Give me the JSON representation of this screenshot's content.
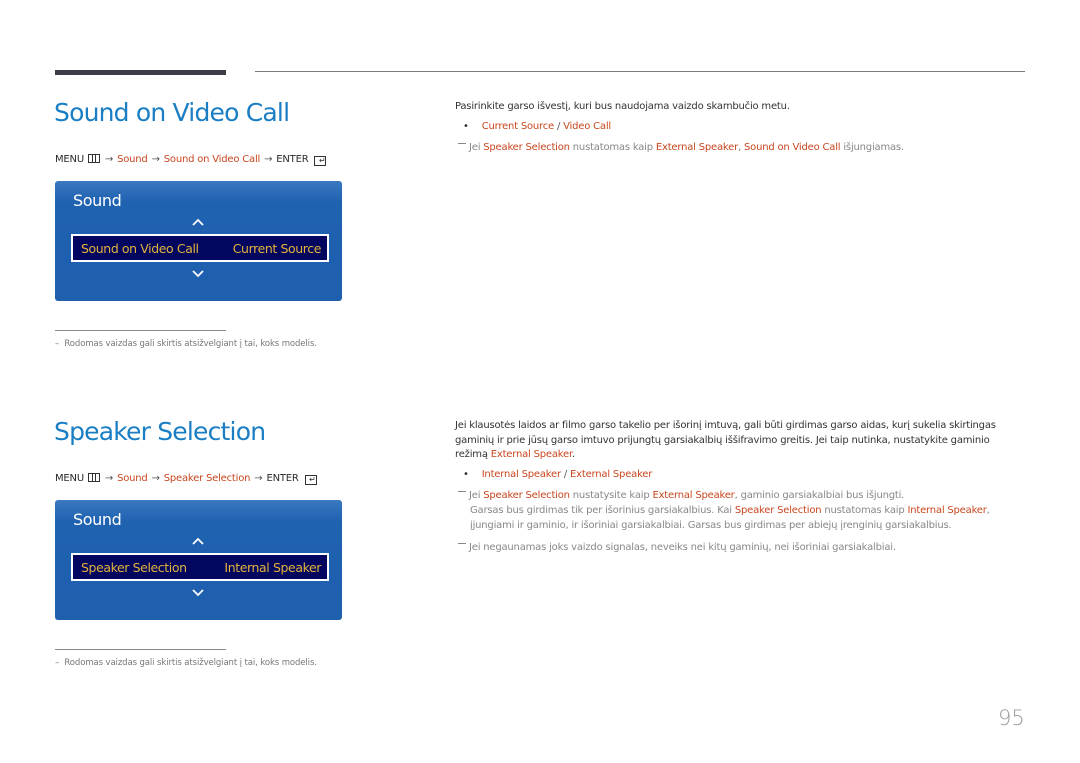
{
  "page_number": "95",
  "sections": [
    {
      "title": "Sound on Video Call",
      "menu_path": {
        "menu": "MENU",
        "menu_icon": "menu-icon",
        "arrow": "→",
        "steps": [
          "Sound",
          "Sound on Video Call"
        ],
        "enter": "ENTER",
        "enter_icon": "enter-icon"
      },
      "osd": {
        "title": "Sound",
        "item_label": "Sound on Video Call",
        "item_value": "Current Source"
      },
      "footnote": "Rodomas vaizdas gali skirtis atsižvelgiant į tai, koks modelis.",
      "footnote_dash": "–",
      "description": "Pasirinkite garso išvestį, kuri bus naudojama vaizdo skambučio metu.",
      "options": [
        "Current Source",
        "Video Call"
      ],
      "option_separator": "/",
      "notes": [
        {
          "parts": [
            "Jei ",
            "Speaker Selection",
            " nustatomas kaip ",
            "External Speaker",
            ", ",
            "Sound on Video Call",
            " išjungiamas."
          ]
        }
      ]
    },
    {
      "title": "Speaker Selection",
      "menu_path": {
        "menu": "MENU",
        "menu_icon": "menu-icon",
        "arrow": "→",
        "steps": [
          "Sound",
          "Speaker Selection"
        ],
        "enter": "ENTER",
        "enter_icon": "enter-icon"
      },
      "osd": {
        "title": "Sound",
        "item_label": "Speaker Selection",
        "item_value": "Internal Speaker"
      },
      "footnote": "Rodomas vaizdas gali skirtis atsižvelgiant į tai, koks modelis.",
      "footnote_dash": "–",
      "description_parts": [
        "Jei klausotės laidos ar filmo garso takelio per išorinį imtuvą, gali būti girdimas garso aidas, kurį sukelia skirtingas gaminių ir prie jūsų garso imtuvo prijungtų garsiakalbių iššifravimo greitis. Jei taip nutinka, nustatykite gaminio režimą ",
        "External Speaker",
        "."
      ],
      "options": [
        "Internal Speaker",
        "External Speaker"
      ],
      "option_separator": "/",
      "notes": [
        {
          "parts": [
            "Jei ",
            "Speaker Selection",
            " nustatysite kaip ",
            "External Speaker",
            ", gaminio garsiakalbiai bus išjungti."
          ],
          "continuation_parts": [
            "Garsas bus girdimas tik per išorinius garsiakalbius. Kai ",
            "Speaker Selection",
            " nustatomas kaip ",
            "Internal Speaker",
            ", įjungiami ir gaminio, ir išoriniai garsiakalbiai. Garsas bus girdimas per abiejų įrenginių garsiakalbius."
          ]
        },
        {
          "parts": [
            "Jei negaunamas joks vaizdo signalas, neveiks nei kitų gaminių, nei išoriniai garsiakalbiai."
          ]
        }
      ]
    }
  ],
  "colors": {
    "title_blue": "#1a7ec4",
    "highlight_orange": "#c8461f",
    "osd_blue": "#1f62b0",
    "osd_row_bg": "#03065e",
    "osd_row_text": "#e3b23c"
  }
}
